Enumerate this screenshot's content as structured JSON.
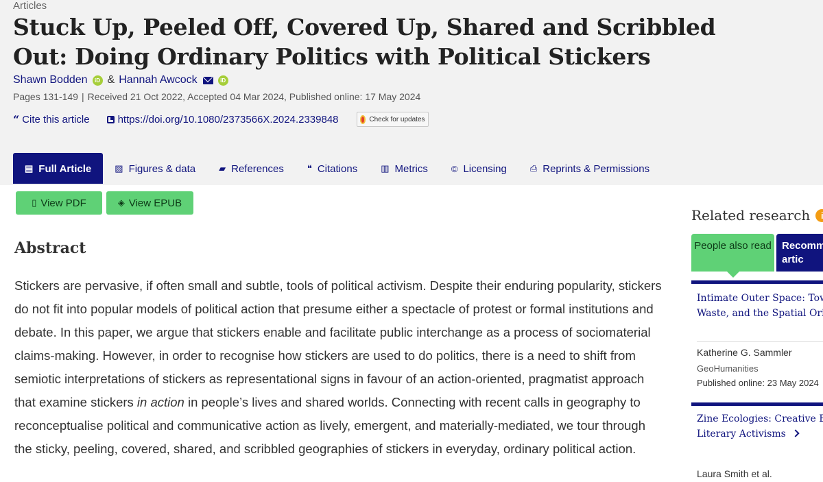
{
  "article": {
    "kicker": "Articles",
    "title": "Stuck Up, Peeled Off, Covered Up, Shared and Scribbled Out: Doing Ordinary Politics with Political Stickers",
    "authors": [
      {
        "name": "Shawn Bodden"
      },
      {
        "name": "Hannah Awcock"
      }
    ],
    "ampersand": "&",
    "orcid_label": "iD",
    "pages": "Pages 131-149",
    "received": "Received 21 Oct 2022, Accepted 04 Mar 2024, Published online: 17 May 2024",
    "cite_label": "Cite this article",
    "doi": "https://doi.org/10.1080/2373566X.2024.2339848",
    "updates_label": "Check for updates"
  },
  "tabs": [
    {
      "label": "Full Article",
      "icon": "document-icon",
      "active": true
    },
    {
      "label": "Figures & data",
      "icon": "image-icon"
    },
    {
      "label": "References",
      "icon": "book-icon"
    },
    {
      "label": "Citations",
      "icon": "quote-icon"
    },
    {
      "label": "Metrics",
      "icon": "bar-chart-icon"
    },
    {
      "label": "Licensing",
      "icon": "copyright-icon"
    },
    {
      "label": "Reprints & Permissions",
      "icon": "print-icon"
    }
  ],
  "buttons": {
    "pdf": "View PDF",
    "epub": "View EPUB"
  },
  "abstract": {
    "heading": "Abstract",
    "text_before": "Stickers are pervasive, if often small and subtle, tools of political activism. Despite their enduring popularity, stickers do not fit into popular models of political action that presume either a spectacle of protest or formal institutions and debate. In this paper, we argue that stickers enable and facilitate public interchange as a process of sociomaterial claims-making. However, in order to recognise how stickers are used to do politics, there is a need to shift from semiotic interpretations of stickers as representational signs in favour of an action-oriented, pragmatist approach that examine stickers ",
    "text_em": "in action",
    "text_after": " in people’s lives and shared worlds. Connecting with recent calls in geography to reconceptualise political and communicative action as lively, emergent, and materially-mediated, we tour through the sticky, peeling, covered, shared, and scribbled geographies of stickers in everyday, ordinary political action."
  },
  "related": {
    "heading": "Related research",
    "info_icon": "i",
    "tab_one": "People also read",
    "tab_two": "Recomm artic",
    "items": [
      {
        "title_line1": "Intimate Outer Space: Towa",
        "title_line2": "Waste, and the Spatial Orier",
        "author": "Katherine G. Sammler",
        "journal": "GeoHumanities",
        "date": "Published online: 23 May 2024"
      },
      {
        "title_line1": "Zine Ecologies: Creative Env",
        "title_line2": "Literary Activisms",
        "author": "Laura Smith et al."
      }
    ]
  },
  "colors": {
    "brand_navy": "#10147e",
    "accent_green": "#5fd176",
    "header_bg": "#f2f2f2"
  }
}
